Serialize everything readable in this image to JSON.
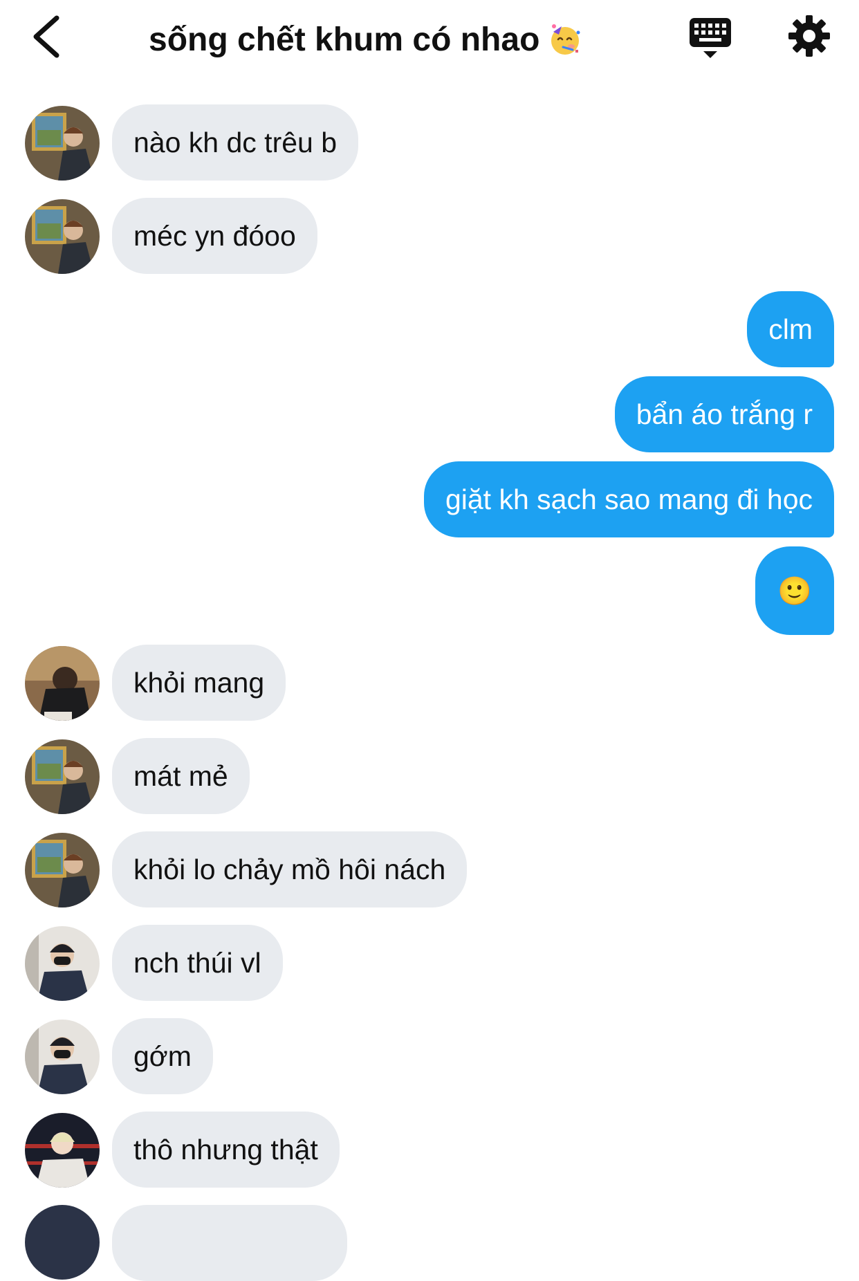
{
  "header": {
    "title": "sống chết khum có nhao",
    "title_emoji": "partying-face-emoji",
    "back_icon": "chevron-left-icon",
    "keyboard_icon": "keyboard-icon",
    "settings_icon": "gear-icon"
  },
  "colors": {
    "incoming_bubble": "#e8ebef",
    "outgoing_bubble": "#1da1f2",
    "text_dark": "#111111",
    "text_light": "#ffffff"
  },
  "messages": [
    {
      "side": "in",
      "text": "nào kh dc trêu b",
      "avatar": "avatar-a"
    },
    {
      "side": "in",
      "text": "méc yn đóoo",
      "avatar": "avatar-a"
    },
    {
      "side": "out",
      "text": "clm"
    },
    {
      "side": "out",
      "text": "bẩn áo trắng r"
    },
    {
      "side": "out",
      "text": "giặt kh sạch sao mang đi học"
    },
    {
      "side": "out",
      "text": "🙂"
    },
    {
      "side": "in",
      "text": "khỏi mang",
      "avatar": "avatar-b"
    },
    {
      "side": "in",
      "text": "mát mẻ",
      "avatar": "avatar-a"
    },
    {
      "side": "in",
      "text": "khỏi lo chảy mồ hôi nách",
      "avatar": "avatar-a"
    },
    {
      "side": "in",
      "text": "nch thúi vl",
      "avatar": "avatar-c"
    },
    {
      "side": "in",
      "text": "gớm",
      "avatar": "avatar-c"
    },
    {
      "side": "in",
      "text": "thô nhưng thật",
      "avatar": "avatar-d"
    }
  ]
}
